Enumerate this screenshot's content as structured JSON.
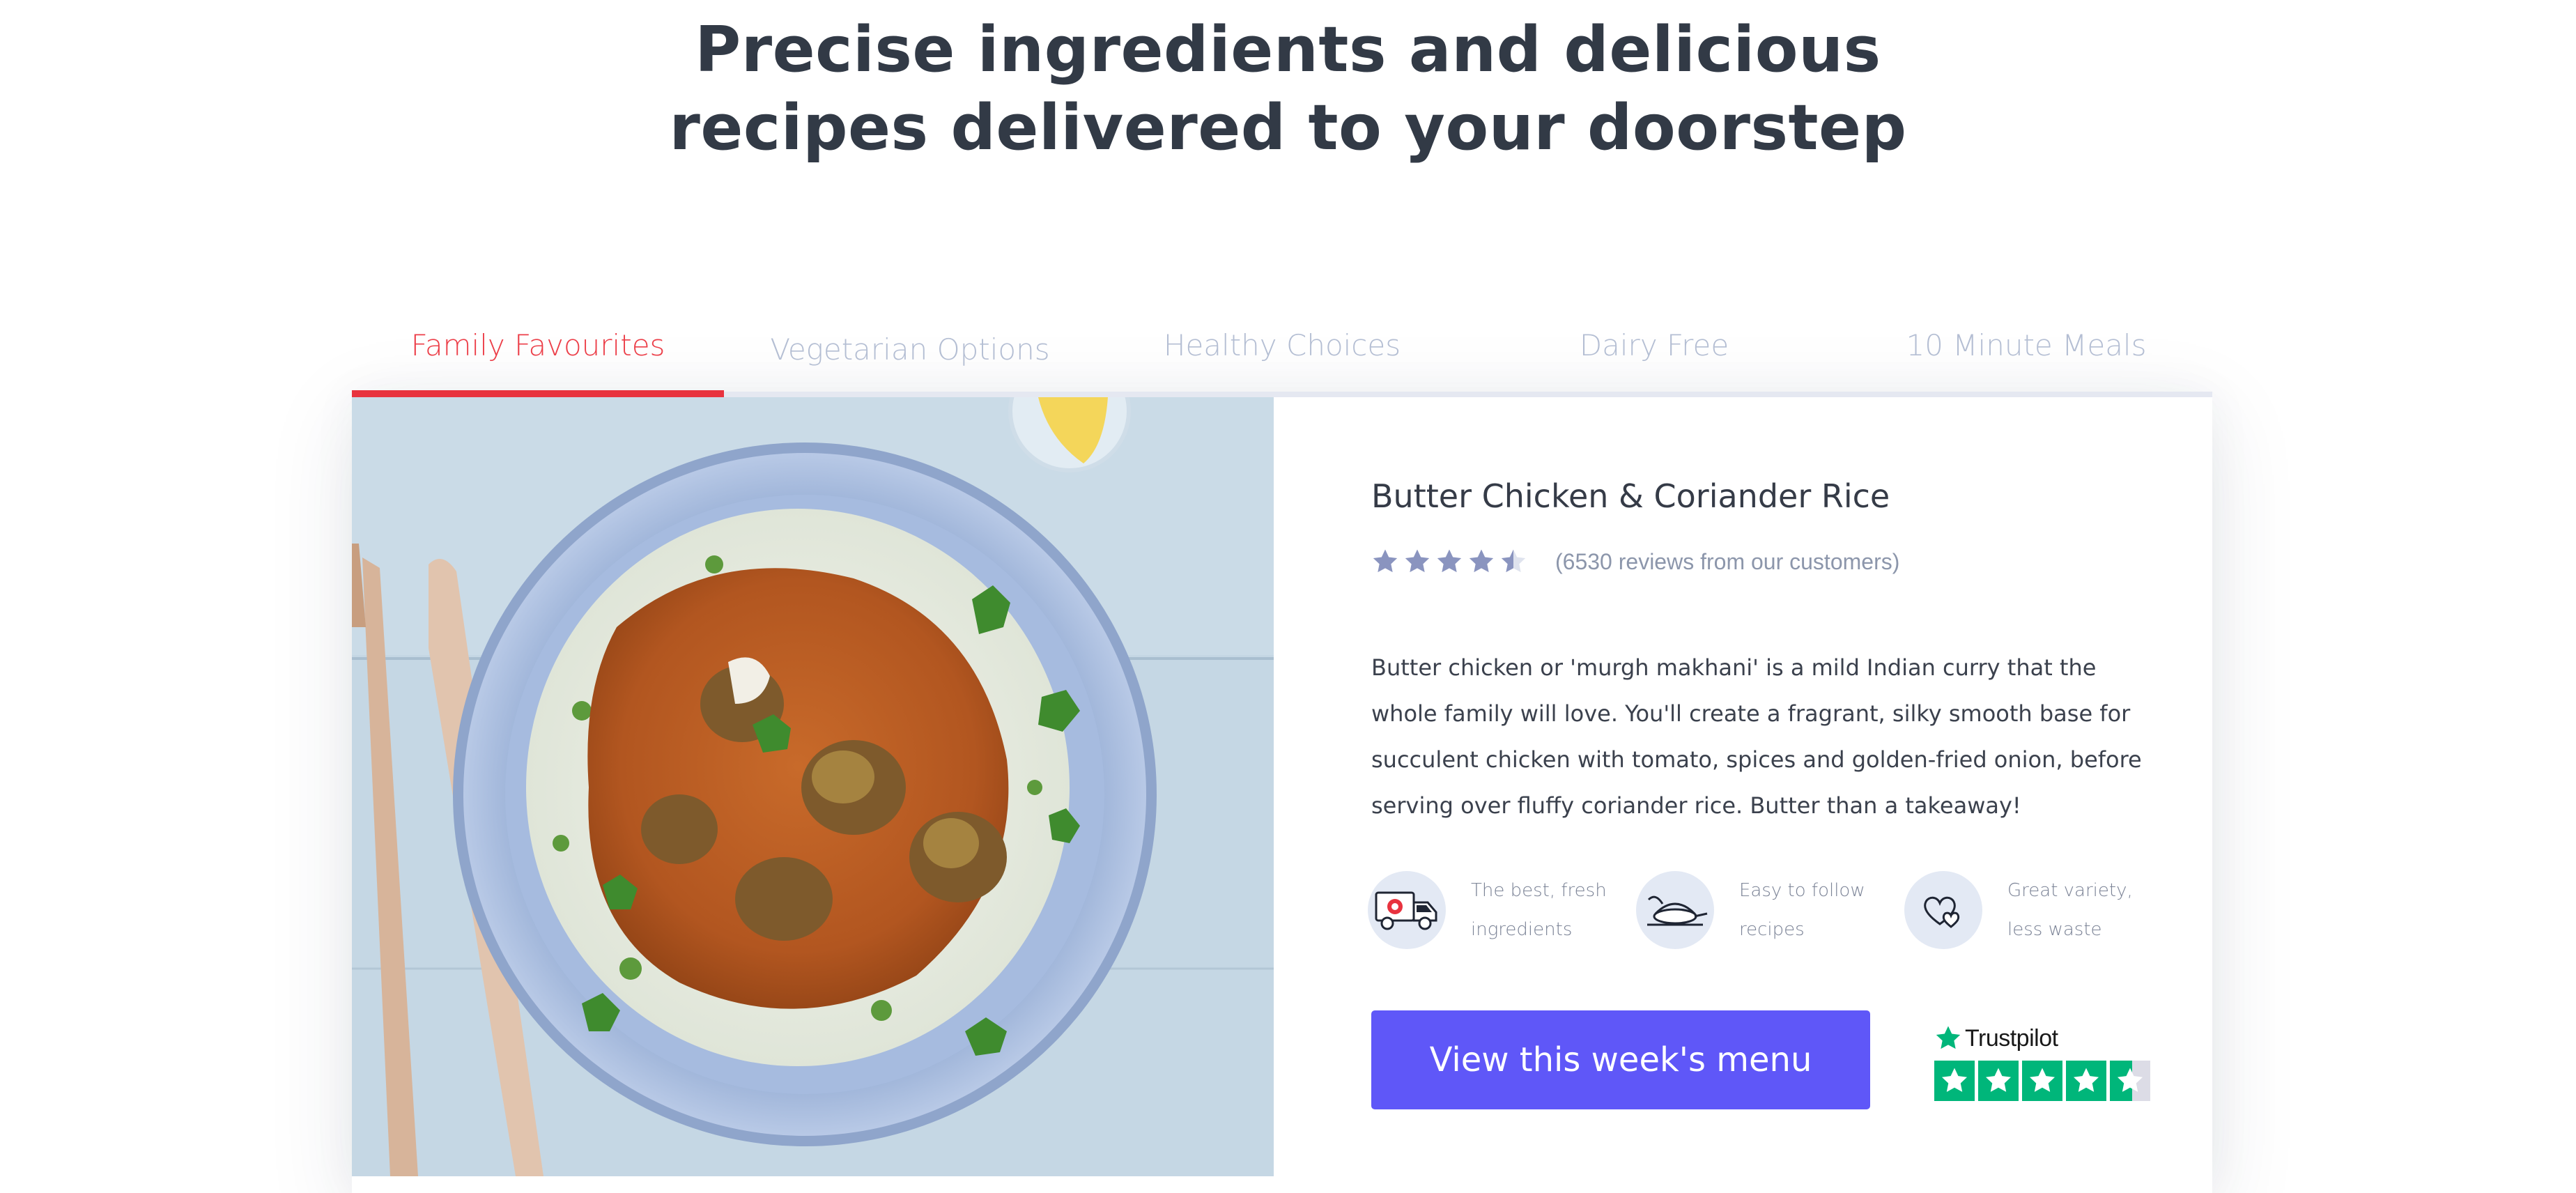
{
  "headline": {
    "line1": "Precise ingredients and delicious",
    "line2": "recipes delivered to your doorstep"
  },
  "tabs": [
    {
      "label": "Family Favourites",
      "active": true
    },
    {
      "label": "Vegetarian Options",
      "active": false
    },
    {
      "label": "Healthy Choices",
      "active": false
    },
    {
      "label": "Dairy Free",
      "active": false
    },
    {
      "label": "10 Minute Meals",
      "active": false
    }
  ],
  "recipe": {
    "title": "Butter Chicken & Coriander Rice",
    "rating": 4.5,
    "reviews_text": "(6530 reviews from our customers)",
    "description": "Butter chicken or 'murgh makhani' is a mild Indian curry that the whole family will love. You'll create a fragrant, silky smooth base for succulent chicken with tomato, spices and golden-fried onion, before serving over fluffy coriander rice. Butter than a takeaway!"
  },
  "features": [
    {
      "icon": "delivery-truck-icon",
      "line1": "The best, fresh",
      "line2": "ingredients"
    },
    {
      "icon": "recipe-dish-icon",
      "line1": "Easy to follow",
      "line2": "recipes"
    },
    {
      "icon": "hearts-icon",
      "line1": "Great variety,",
      "line2": "less waste"
    }
  ],
  "cta": {
    "label": "View this week's menu"
  },
  "trustpilot": {
    "brand": "Trustpilot",
    "rating": 4.5
  },
  "colors": {
    "accent_red": "#e8333f",
    "button_purple": "#5f57f8",
    "star_grey_blue": "#8a94bf",
    "trustpilot_green": "#00b67a"
  }
}
